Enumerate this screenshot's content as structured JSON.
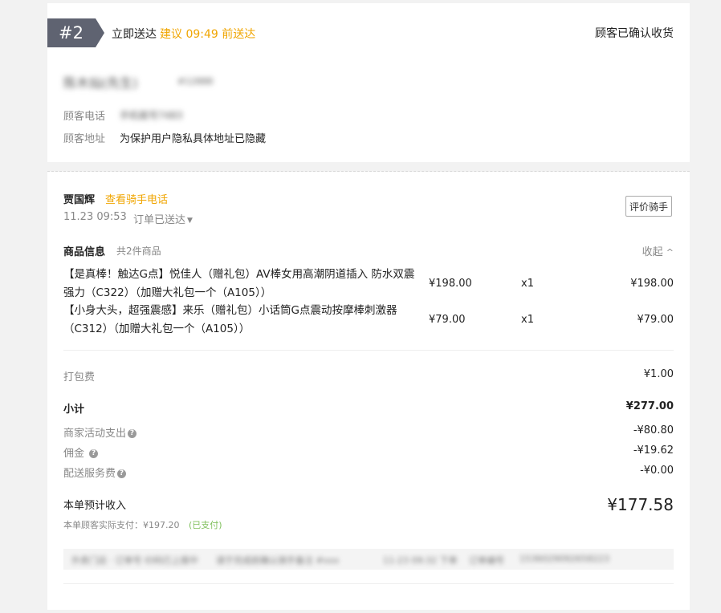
{
  "header": {
    "order_number": "#2",
    "delivery_type": "立即送达",
    "suggest_time": "建议 09:49 前送达",
    "status": "顾客已确认收货"
  },
  "customer": {
    "name": "陈木灿(先生)",
    "order_count": "#12888",
    "phone_label": "顾客电话",
    "phone_value": "手机尾号7483",
    "address_label": "顾客地址",
    "address_value": "为保护用户隐私具体地址已隐藏"
  },
  "rider": {
    "name": "贾国辉",
    "phone_link": "查看骑手电话",
    "time": "11.23 09:53",
    "status": "订单已送达",
    "rate_button": "评价骑手"
  },
  "goods": {
    "title": "商品信息",
    "count_text": "共2件商品",
    "collapse_label": "收起",
    "items": [
      {
        "name": "【是真棒！触达G点】悦佳人（赠礼包）AV棒女用高潮阴道插入 防水双震强力（C322）（加赠大礼包一个（A105））",
        "price": "¥198.00",
        "qty": "x1",
        "total": "¥198.00"
      },
      {
        "name": "【小身大头，超强震感】来乐（赠礼包）小话筒G点震动按摩棒刺激器（C312）（加赠大礼包一个（A105））",
        "price": "¥79.00",
        "qty": "x1",
        "total": "¥79.00"
      }
    ]
  },
  "fees": {
    "packing_label": "打包费",
    "packing_value": "¥1.00",
    "subtotal_label": "小计",
    "subtotal_value": "¥277.00",
    "activity_label": "商家活动支出",
    "activity_value": "-¥80.80",
    "commission_label": "佣金",
    "commission_value": "-¥19.62",
    "delivery_label": "配送服务费",
    "delivery_value": "-¥0.00",
    "income_label": "本单预计收入",
    "income_value": "¥177.58",
    "paid_text": "本单顾客实际支付：¥197.20",
    "paid_status": "(已支付)"
  },
  "footer_info": {
    "remark": "外卖门店 · 订单号 ID码已上报中",
    "note": "请于完成前确认骑手备注 #xxx",
    "datetime": "11-23 09:32 下单",
    "channel": "订单编号",
    "order_id": "1536029092658223"
  }
}
